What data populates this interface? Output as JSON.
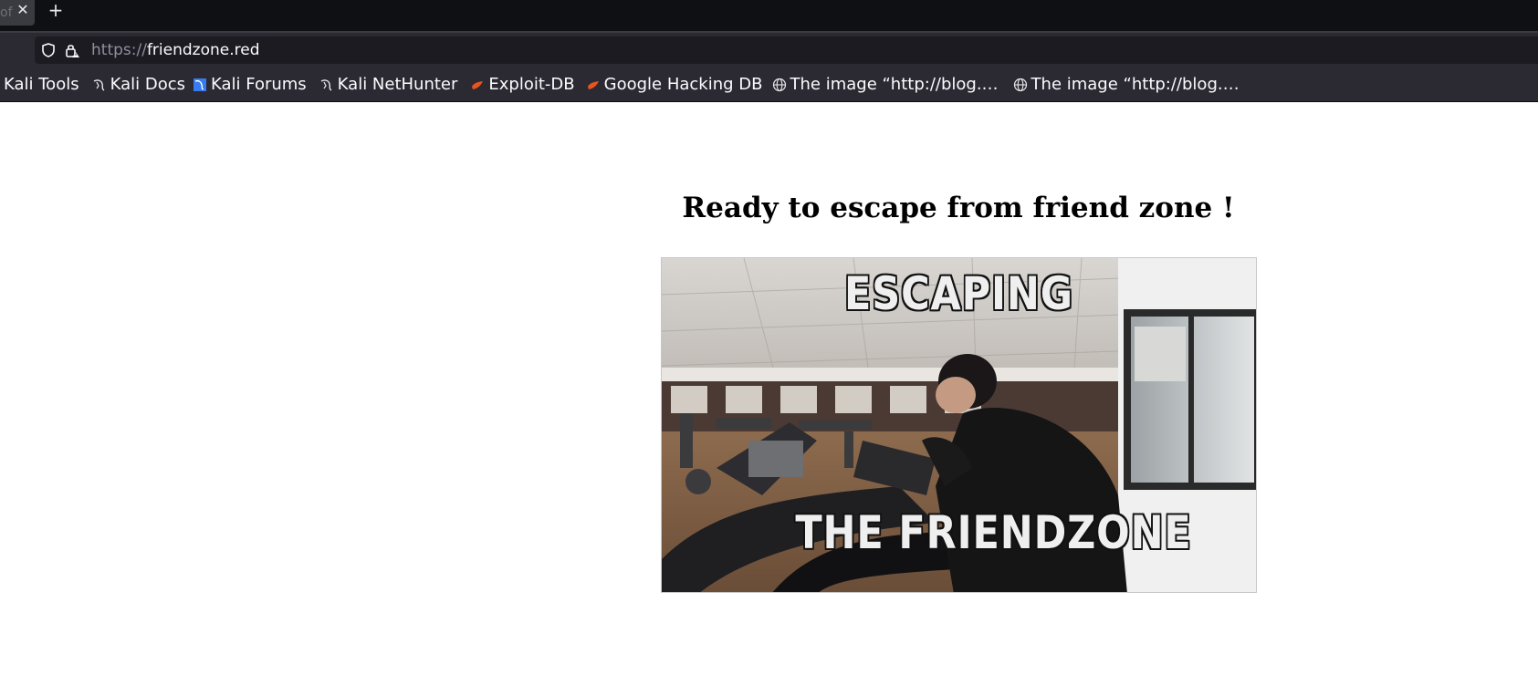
{
  "tabbar": {
    "partial_tab_text": "of",
    "close_glyph": "✕",
    "new_tab_glyph": "+"
  },
  "urlbar": {
    "scheme": "https://",
    "host": "friendzone.red",
    "icons": [
      "shield-icon",
      "lock-icon"
    ]
  },
  "bookmarks": [
    {
      "label": "Kali Tools",
      "icon": "none"
    },
    {
      "label": "Kali Docs",
      "icon": "kali-dragon-icon"
    },
    {
      "label": "Kali Forums",
      "icon": "kali-forums-icon"
    },
    {
      "label": "Kali NetHunter",
      "icon": "kali-dragon-icon"
    },
    {
      "label": "Exploit-DB",
      "icon": "exploit-db-icon"
    },
    {
      "label": "Google Hacking DB",
      "icon": "exploit-db-icon"
    },
    {
      "label": "The image “http://blog.…",
      "icon": "globe-icon"
    },
    {
      "label": "The image “http://blog.…",
      "icon": "globe-icon"
    }
  ],
  "page": {
    "heading": "Ready to escape from friend zone !",
    "gif": {
      "caption_top": "ESCAPING",
      "caption_bottom": "THE  FRIENDZONE"
    }
  },
  "colors": {
    "tabbar_bg": "#0f1014",
    "toolbar_bg": "#2b2a33",
    "urlbar_bg": "#1c1b22",
    "exploit_db_orange": "#e8541e"
  }
}
